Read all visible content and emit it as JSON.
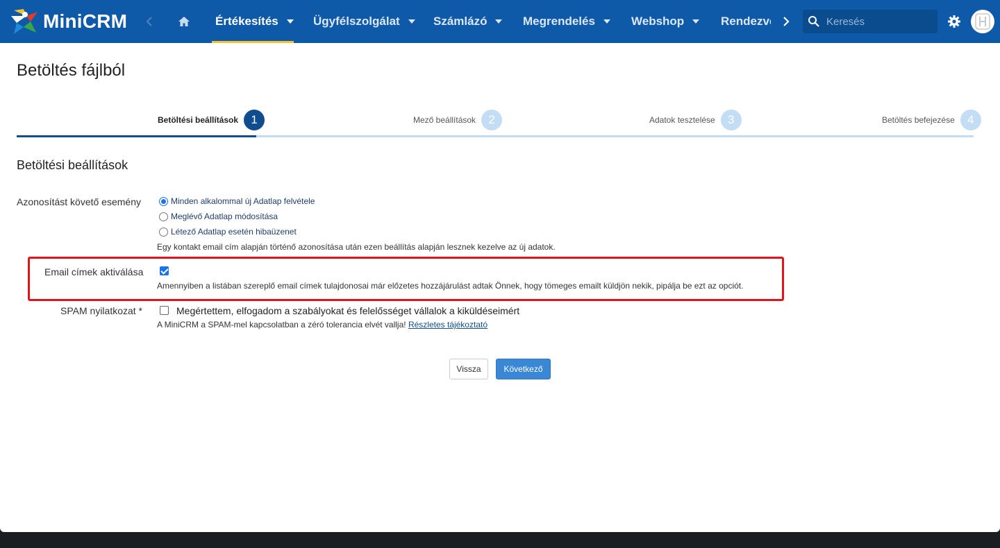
{
  "app": {
    "brand": "MiniCRM"
  },
  "nav": {
    "items": [
      {
        "label": "Értékesítés",
        "active": true
      },
      {
        "label": "Ügyfélszolgálat"
      },
      {
        "label": "Számlázó"
      },
      {
        "label": "Megrendelés"
      },
      {
        "label": "Webshop"
      },
      {
        "label": "Rendezvé"
      }
    ],
    "search_placeholder": "Keresés"
  },
  "page": {
    "title": "Betöltés fájlból"
  },
  "stepper": {
    "steps": [
      {
        "label": "Betöltési beállítások",
        "num": "1",
        "active": true
      },
      {
        "label": "Mező beállítások",
        "num": "2"
      },
      {
        "label": "Adatok tesztelése",
        "num": "3"
      },
      {
        "label": "Betöltés befejezése",
        "num": "4"
      }
    ]
  },
  "form": {
    "section_title": "Betöltési beállítások",
    "event": {
      "label": "Azonosítást követő esemény",
      "options": [
        {
          "label": "Minden alkalommal új Adatlap felvétele",
          "checked": true
        },
        {
          "label": "Meglévő Adatlap módosítása",
          "checked": false
        },
        {
          "label": "Létező Adatlap esetén hibaüzenet",
          "checked": false
        }
      ],
      "help": "Egy kontakt email cím alapján történő azonosítása után ezen beállítás alapján lesznek kezelve az új adatok."
    },
    "email": {
      "label": "Email címek aktiválása",
      "checked": true,
      "help": "Amennyiben a listában szereplő email címek tulajdonosai már előzetes hozzájárulást adtak Önnek, hogy tömeges emailt küldjön nekik, pipálja be ezt az opciót."
    },
    "spam": {
      "label": "SPAM nyilatkozat *",
      "checked": false,
      "text": "Megértettem, elfogadom a szabályokat és felelősséget vállalok a kiküldéseimért",
      "help": "A MiniCRM a SPAM-mel kapcsolatban a zéró tolerancia elvét vallja!",
      "link": "Részletes tájékoztató"
    }
  },
  "buttons": {
    "back": "Vissza",
    "next": "Következő"
  },
  "colors": {
    "navbar": "#0f5aa8",
    "active_underline": "#f2c230",
    "step_active": "#0f4d8f",
    "step_inactive": "#c2ddf4",
    "highlight": "#e0141b",
    "primary_button": "#3a87d6"
  },
  "icons": {
    "logo": "minicrm-star-logo",
    "back": "chevron-left-icon",
    "home": "home-icon",
    "next": "chevron-right-icon",
    "search": "search-icon",
    "settings": "gear-icon",
    "avatar": "user-avatar-icon"
  }
}
